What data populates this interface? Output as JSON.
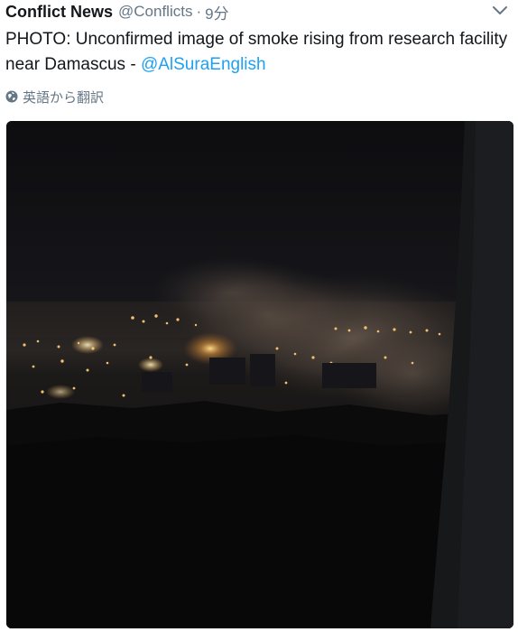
{
  "tweet": {
    "author_name": "Conflict News",
    "author_handle": "@Conflicts",
    "separator": "·",
    "time": "9分",
    "text": "PHOTO: Unconfirmed image of smoke rising from research facility near Damascus - ",
    "mention": "@AlSuraEnglish",
    "translate_label": "英語から翻訳",
    "menu_icon": "chevron-down-icon",
    "translate_icon": "globe-icon"
  },
  "media": {
    "type": "photo",
    "description_icon": "night-smoke-photo"
  },
  "colors": {
    "text": "#14171a",
    "secondary": "#657786",
    "link": "#1da1f2",
    "background": "#ffffff"
  }
}
